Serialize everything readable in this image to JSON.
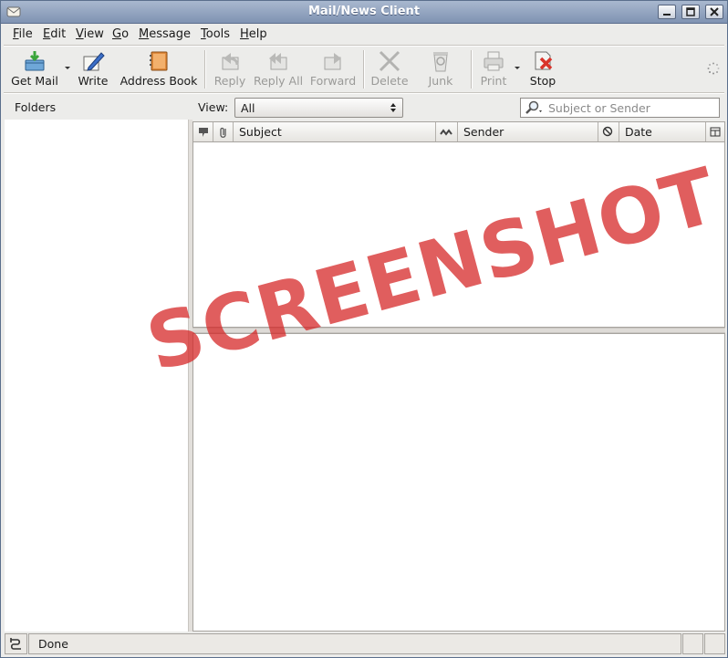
{
  "window": {
    "title": "Mail/News Client"
  },
  "menu": [
    "File",
    "Edit",
    "View",
    "Go",
    "Message",
    "Tools",
    "Help"
  ],
  "menu_mnemonic": [
    "F",
    "E",
    "V",
    "G",
    "M",
    "T",
    "H"
  ],
  "toolbar": {
    "get_mail": "Get Mail",
    "write": "Write",
    "address_book": "Address Book",
    "reply": "Reply",
    "reply_all": "Reply All",
    "forward": "Forward",
    "delete": "Delete",
    "junk": "Junk",
    "print": "Print",
    "stop": "Stop"
  },
  "folders": {
    "header": "Folders"
  },
  "view_filter": {
    "label": "View:",
    "selected": "All"
  },
  "search": {
    "placeholder": "Subject or Sender",
    "value": ""
  },
  "columns": {
    "subject": "Subject",
    "sender": "Sender",
    "date": "Date"
  },
  "watermark": "SCREENSHOT",
  "status": {
    "text": "Done"
  },
  "colors": {
    "titlebar": "#8fa1be",
    "watermark": "#d62828",
    "stop_icon": "#d9342b"
  }
}
